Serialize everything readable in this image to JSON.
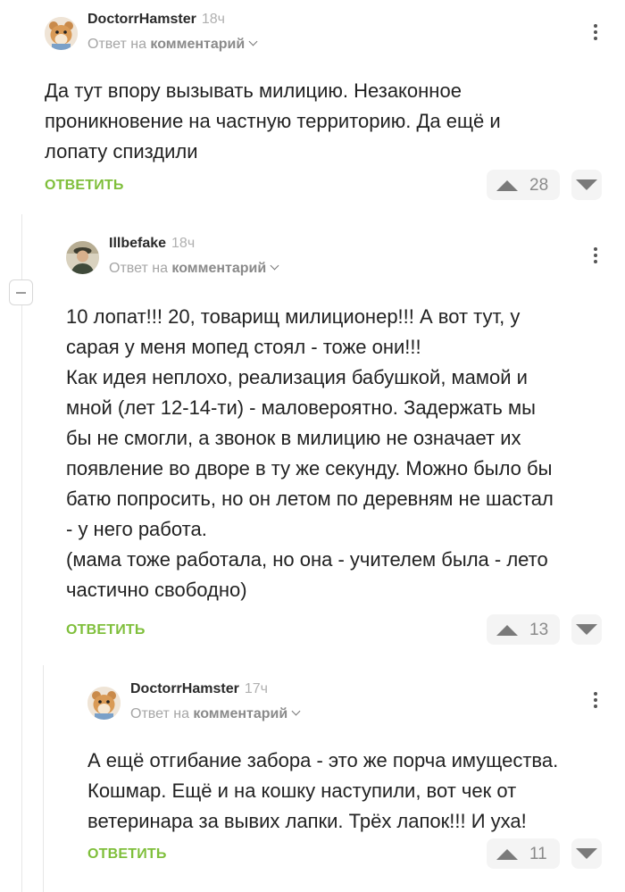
{
  "comments": [
    {
      "author": "DoctorrHamster",
      "time": "18ч",
      "reply_prefix": "Ответ на",
      "reply_target": "комментарий",
      "text": "Да тут впору вызывать милицию. Незаконное\nпроникновение на частную территорию. Да ещё и\nлопату спиздили",
      "reply_label": "ОТВЕТИТЬ",
      "rating": "28",
      "avatar_icon": "hamster-avatar"
    },
    {
      "author": "Illbefake",
      "time": "18ч",
      "reply_prefix": "Ответ на",
      "reply_target": "комментарий",
      "text": "10 лопат!!! 20, товарищ милиционер!!! А вот тут, у\nсарая у меня мопед стоял - тоже они!!!\nКак идея неплохо, реализация бабушкой, мамой и\nмной (лет 12-14-ти) - маловероятно. Задержать мы\nбы не смогли, а звонок в милицию не означает их\nпоявление во дворе в ту же секунду. Можно было бы\nбатю попросить, но он летом по деревням не шастал\n- у него работа.\n(мама тоже работала, но она - учителем была - лето\nчастично свободно)",
      "reply_label": "ОТВЕТИТЬ",
      "rating": "13",
      "avatar_icon": "person-avatar"
    },
    {
      "author": "DoctorrHamster",
      "time": "17ч",
      "reply_prefix": "Ответ на",
      "reply_target": "комментарий",
      "text": "А ещё отгибание забора - это же порча имущества.\nКошмар. Ещё и на кошку наступили, вот чек от\nветеринара за вывих лапки. Трёх лапок!!! И уха!",
      "reply_label": "ОТВЕТИТЬ",
      "rating": "11",
      "avatar_icon": "hamster-avatar"
    }
  ],
  "colors": {
    "accent_green": "#7fbf3b",
    "muted_text": "#a5a5a5",
    "vote_bg": "#f4f4f4"
  }
}
